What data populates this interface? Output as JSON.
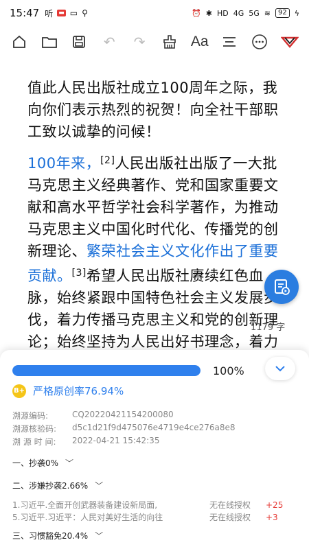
{
  "status_bar": {
    "time": "15:47",
    "left_text": "听",
    "battery": "92",
    "signal_4g": "4G",
    "signal_5g": "5G",
    "hd": "HD"
  },
  "toolbar": {
    "font_label": "Aa",
    "icons": [
      "home-icon",
      "folder-icon",
      "save-icon",
      "undo-icon",
      "redo-icon",
      "clean-icon",
      "font-icon",
      "paragraph-icon",
      "more-icon",
      "logo-icon"
    ]
  },
  "document": {
    "para1": "值此人民出版社成立100周年之际，我向你们表示热烈的祝贺！向全社干部职工致以诚挚的问候！",
    "para2_blue_1": "100年来，",
    "para2_sup_1": "[2]",
    "para2_text_1": "人民出版社出版了一大批马克思主义经典著作、党和国家重要文献和高水平哲学社会科学著作，为推动马克思主义中国化时代化、传播党的创新理论、",
    "para2_blue_2": "繁荣社会主义文化作出了重要贡献。",
    "para2_sup_2": "[3]",
    "para2_text_2": "希望人民出版社赓续红色血脉，始终紧跟中国特色社会主义发展步伐，着力传播马克思主义和党的创新理论；始终坚持为人民出好书理念，着力展现"
  },
  "word_count": "1179 字",
  "sheet": {
    "progress": 100,
    "progress_text": "100%",
    "grade": "B+",
    "originality": "严格原创率76.94%",
    "meta": [
      {
        "label": "溯源编码:",
        "value": "CQ20220421154200080"
      },
      {
        "label": "溯源核验码:",
        "value": "d5c1d21f9d475076e4719e4ce276a8e8"
      },
      {
        "label": "溯 源 时 间:",
        "value": "2022-04-21 15:42:35"
      }
    ],
    "sections": {
      "s1": "一、抄袭0%",
      "s2": "二、涉嫌抄袭2.66%",
      "s3": "三、习惯豁免20.4%"
    },
    "items": [
      {
        "title": "1.习近平.全面开创武器装备建设新局面,",
        "auth": "无在线授权",
        "score": "+25"
      },
      {
        "title": "5.习近平.习近平：人民对美好生活的向往",
        "auth": "无在线授权",
        "score": "+3"
      }
    ]
  },
  "colors": {
    "accent": "#2f80ed",
    "link_blue": "#1a6fd8",
    "red": "#e53935",
    "grade": "#f5c518"
  }
}
